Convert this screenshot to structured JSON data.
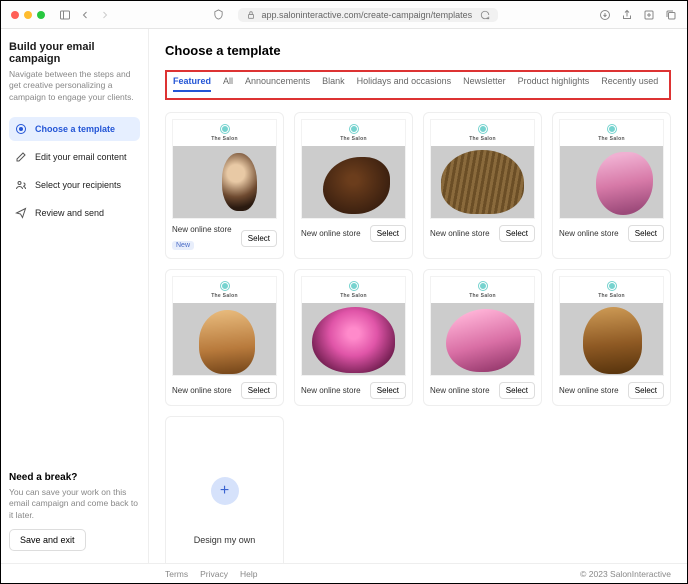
{
  "browser": {
    "url": "app.saloninteractive.com/create-campaign/templates"
  },
  "sidebar": {
    "title": "Build your email campaign",
    "description": "Navigate between the steps and get creative personalizing a campaign to engage your clients.",
    "steps": [
      {
        "label": "Choose a template"
      },
      {
        "label": "Edit your email content"
      },
      {
        "label": "Select your recipients"
      },
      {
        "label": "Review and send"
      }
    ],
    "break": {
      "heading": "Need a break?",
      "text": "You can save your work on this email campaign and come back to it later.",
      "button": "Save and exit"
    }
  },
  "main": {
    "heading": "Choose a template",
    "tabs": [
      "Featured",
      "All",
      "Announcements",
      "Blank",
      "Holidays and occasions",
      "Newsletter",
      "Product highlights",
      "Recently used"
    ],
    "brand_label": "The Salon",
    "templates": [
      {
        "title": "New online store",
        "badge": "New"
      },
      {
        "title": "New online store"
      },
      {
        "title": "New online store"
      },
      {
        "title": "New online store"
      },
      {
        "title": "New online store"
      },
      {
        "title": "New online store"
      },
      {
        "title": "New online store"
      },
      {
        "title": "New online store"
      }
    ],
    "select_label": "Select",
    "design_own": "Design my own"
  },
  "footer": {
    "links": [
      "Terms",
      "Privacy",
      "Help"
    ],
    "copyright": "© 2023 SalonInteractive"
  }
}
